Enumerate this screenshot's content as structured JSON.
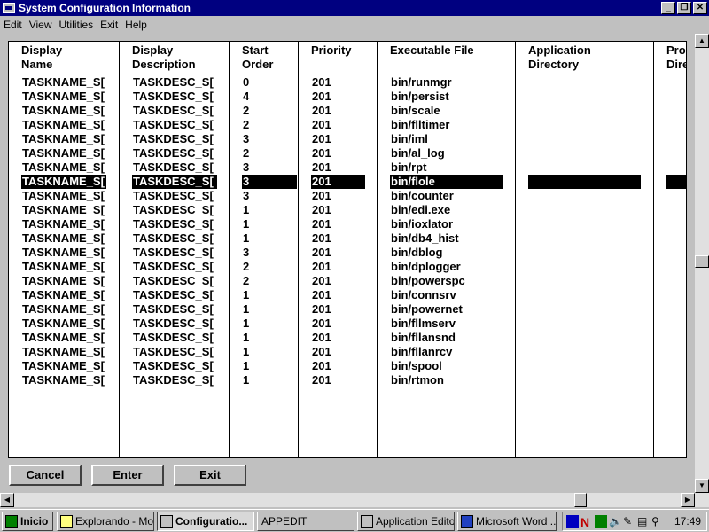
{
  "window": {
    "title": "System Configuration Information"
  },
  "menu": [
    "Edit",
    "View",
    "Utilities",
    "Exit",
    "Help"
  ],
  "columns": [
    {
      "label": "Display\nName"
    },
    {
      "label": "Display\nDescription"
    },
    {
      "label": "Start\nOrder"
    },
    {
      "label": "Priority"
    },
    {
      "label": "Executable File"
    },
    {
      "label": "Application\nDirectory"
    },
    {
      "label": "Pro\nDire"
    }
  ],
  "rows": [
    [
      "TASKNAME_S[",
      "TASKDESC_S[",
      "0",
      "201",
      "bin/runmgr"
    ],
    [
      "TASKNAME_S[",
      "TASKDESC_S[",
      "4",
      "201",
      "bin/persist"
    ],
    [
      "TASKNAME_S[",
      "TASKDESC_S[",
      "2",
      "201",
      "bin/scale"
    ],
    [
      "TASKNAME_S[",
      "TASKDESC_S[",
      "2",
      "201",
      "bin/flltimer"
    ],
    [
      "TASKNAME_S[",
      "TASKDESC_S[",
      "3",
      "201",
      "bin/iml"
    ],
    [
      "TASKNAME_S[",
      "TASKDESC_S[",
      "2",
      "201",
      "bin/al_log"
    ],
    [
      "TASKNAME_S[",
      "TASKDESC_S[",
      "3",
      "201",
      "bin/rpt"
    ],
    [
      "TASKNAME_S[",
      "TASKDESC_S[",
      "3",
      "201",
      "bin/flole"
    ],
    [
      "TASKNAME_S[",
      "TASKDESC_S[",
      "3",
      "201",
      "bin/counter"
    ],
    [
      "TASKNAME_S[",
      "TASKDESC_S[",
      "1",
      "201",
      "bin/edi.exe"
    ],
    [
      "TASKNAME_S[",
      "TASKDESC_S[",
      "1",
      "201",
      "bin/ioxlator"
    ],
    [
      "TASKNAME_S[",
      "TASKDESC_S[",
      "1",
      "201",
      "bin/db4_hist"
    ],
    [
      "TASKNAME_S[",
      "TASKDESC_S[",
      "3",
      "201",
      "bin/dblog"
    ],
    [
      "TASKNAME_S[",
      "TASKDESC_S[",
      "2",
      "201",
      "bin/dplogger"
    ],
    [
      "TASKNAME_S[",
      "TASKDESC_S[",
      "2",
      "201",
      "bin/powerspc"
    ],
    [
      "TASKNAME_S[",
      "TASKDESC_S[",
      "1",
      "201",
      "bin/connsrv"
    ],
    [
      "TASKNAME_S[",
      "TASKDESC_S[",
      "1",
      "201",
      "bin/powernet"
    ],
    [
      "TASKNAME_S[",
      "TASKDESC_S[",
      "1",
      "201",
      "bin/fllmserv"
    ],
    [
      "TASKNAME_S[",
      "TASKDESC_S[",
      "1",
      "201",
      "bin/fllansnd"
    ],
    [
      "TASKNAME_S[",
      "TASKDESC_S[",
      "1",
      "201",
      "bin/fllanrcv"
    ],
    [
      "TASKNAME_S[",
      "TASKDESC_S[",
      "1",
      "201",
      "bin/spool"
    ],
    [
      "TASKNAME_S[",
      "TASKDESC_S[",
      "1",
      "201",
      "bin/rtmon"
    ]
  ],
  "selected_row": 7,
  "buttons": {
    "cancel": "Cancel",
    "enter": "Enter",
    "exit": "Exit"
  },
  "taskbar": {
    "start": "Inicio",
    "items": [
      "Explorando - Mo...",
      "Configuratio...",
      "APPEDIT",
      "Application Editor",
      "Microsoft Word ..."
    ],
    "active": 1,
    "clock": "17:49"
  }
}
